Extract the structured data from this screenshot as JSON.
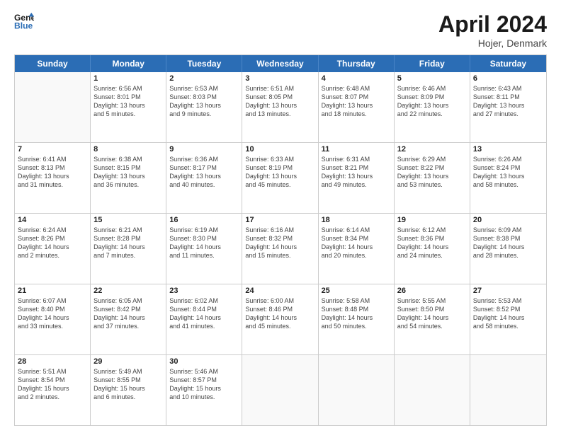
{
  "header": {
    "logo_line1": "General",
    "logo_line2": "Blue",
    "main_title": "April 2024",
    "subtitle": "Hojer, Denmark"
  },
  "days_of_week": [
    "Sunday",
    "Monday",
    "Tuesday",
    "Wednesday",
    "Thursday",
    "Friday",
    "Saturday"
  ],
  "weeks": [
    [
      {
        "day": "",
        "info": ""
      },
      {
        "day": "1",
        "info": "Sunrise: 6:56 AM\nSunset: 8:01 PM\nDaylight: 13 hours\nand 5 minutes."
      },
      {
        "day": "2",
        "info": "Sunrise: 6:53 AM\nSunset: 8:03 PM\nDaylight: 13 hours\nand 9 minutes."
      },
      {
        "day": "3",
        "info": "Sunrise: 6:51 AM\nSunset: 8:05 PM\nDaylight: 13 hours\nand 13 minutes."
      },
      {
        "day": "4",
        "info": "Sunrise: 6:48 AM\nSunset: 8:07 PM\nDaylight: 13 hours\nand 18 minutes."
      },
      {
        "day": "5",
        "info": "Sunrise: 6:46 AM\nSunset: 8:09 PM\nDaylight: 13 hours\nand 22 minutes."
      },
      {
        "day": "6",
        "info": "Sunrise: 6:43 AM\nSunset: 8:11 PM\nDaylight: 13 hours\nand 27 minutes."
      }
    ],
    [
      {
        "day": "7",
        "info": "Sunrise: 6:41 AM\nSunset: 8:13 PM\nDaylight: 13 hours\nand 31 minutes."
      },
      {
        "day": "8",
        "info": "Sunrise: 6:38 AM\nSunset: 8:15 PM\nDaylight: 13 hours\nand 36 minutes."
      },
      {
        "day": "9",
        "info": "Sunrise: 6:36 AM\nSunset: 8:17 PM\nDaylight: 13 hours\nand 40 minutes."
      },
      {
        "day": "10",
        "info": "Sunrise: 6:33 AM\nSunset: 8:19 PM\nDaylight: 13 hours\nand 45 minutes."
      },
      {
        "day": "11",
        "info": "Sunrise: 6:31 AM\nSunset: 8:21 PM\nDaylight: 13 hours\nand 49 minutes."
      },
      {
        "day": "12",
        "info": "Sunrise: 6:29 AM\nSunset: 8:22 PM\nDaylight: 13 hours\nand 53 minutes."
      },
      {
        "day": "13",
        "info": "Sunrise: 6:26 AM\nSunset: 8:24 PM\nDaylight: 13 hours\nand 58 minutes."
      }
    ],
    [
      {
        "day": "14",
        "info": "Sunrise: 6:24 AM\nSunset: 8:26 PM\nDaylight: 14 hours\nand 2 minutes."
      },
      {
        "day": "15",
        "info": "Sunrise: 6:21 AM\nSunset: 8:28 PM\nDaylight: 14 hours\nand 7 minutes."
      },
      {
        "day": "16",
        "info": "Sunrise: 6:19 AM\nSunset: 8:30 PM\nDaylight: 14 hours\nand 11 minutes."
      },
      {
        "day": "17",
        "info": "Sunrise: 6:16 AM\nSunset: 8:32 PM\nDaylight: 14 hours\nand 15 minutes."
      },
      {
        "day": "18",
        "info": "Sunrise: 6:14 AM\nSunset: 8:34 PM\nDaylight: 14 hours\nand 20 minutes."
      },
      {
        "day": "19",
        "info": "Sunrise: 6:12 AM\nSunset: 8:36 PM\nDaylight: 14 hours\nand 24 minutes."
      },
      {
        "day": "20",
        "info": "Sunrise: 6:09 AM\nSunset: 8:38 PM\nDaylight: 14 hours\nand 28 minutes."
      }
    ],
    [
      {
        "day": "21",
        "info": "Sunrise: 6:07 AM\nSunset: 8:40 PM\nDaylight: 14 hours\nand 33 minutes."
      },
      {
        "day": "22",
        "info": "Sunrise: 6:05 AM\nSunset: 8:42 PM\nDaylight: 14 hours\nand 37 minutes."
      },
      {
        "day": "23",
        "info": "Sunrise: 6:02 AM\nSunset: 8:44 PM\nDaylight: 14 hours\nand 41 minutes."
      },
      {
        "day": "24",
        "info": "Sunrise: 6:00 AM\nSunset: 8:46 PM\nDaylight: 14 hours\nand 45 minutes."
      },
      {
        "day": "25",
        "info": "Sunrise: 5:58 AM\nSunset: 8:48 PM\nDaylight: 14 hours\nand 50 minutes."
      },
      {
        "day": "26",
        "info": "Sunrise: 5:55 AM\nSunset: 8:50 PM\nDaylight: 14 hours\nand 54 minutes."
      },
      {
        "day": "27",
        "info": "Sunrise: 5:53 AM\nSunset: 8:52 PM\nDaylight: 14 hours\nand 58 minutes."
      }
    ],
    [
      {
        "day": "28",
        "info": "Sunrise: 5:51 AM\nSunset: 8:54 PM\nDaylight: 15 hours\nand 2 minutes."
      },
      {
        "day": "29",
        "info": "Sunrise: 5:49 AM\nSunset: 8:55 PM\nDaylight: 15 hours\nand 6 minutes."
      },
      {
        "day": "30",
        "info": "Sunrise: 5:46 AM\nSunset: 8:57 PM\nDaylight: 15 hours\nand 10 minutes."
      },
      {
        "day": "",
        "info": ""
      },
      {
        "day": "",
        "info": ""
      },
      {
        "day": "",
        "info": ""
      },
      {
        "day": "",
        "info": ""
      }
    ]
  ]
}
